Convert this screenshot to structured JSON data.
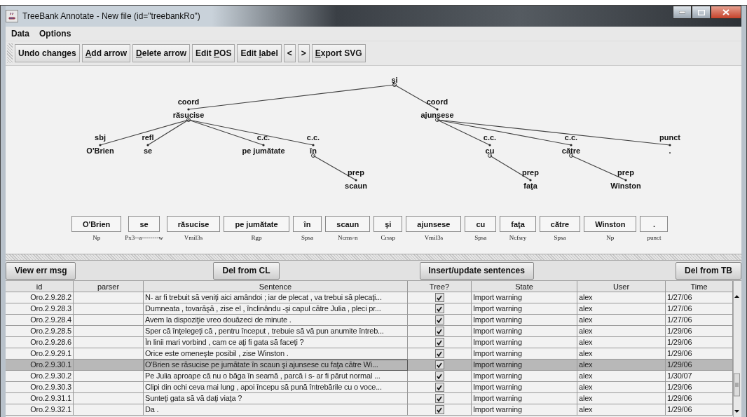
{
  "window": {
    "title": "TreeBank Annotate - New file (id=\"treebankRo\")"
  },
  "menu": [
    "Data",
    "Options"
  ],
  "toolbar": [
    {
      "pre": "Undo changes"
    },
    {
      "key": "A",
      "post": "dd arrow"
    },
    {
      "key": "D",
      "post": "elete arrow"
    },
    {
      "pre": "Edit ",
      "key": "P",
      "post": "OS"
    },
    {
      "pre": "Edit ",
      "key": "l",
      "post": "abel"
    },
    {
      "pre": "<"
    },
    {
      "pre": ">"
    },
    {
      "key": "E",
      "post": "xport SVG"
    }
  ],
  "tree": {
    "word": "şi",
    "children": [
      {
        "relation": "coord",
        "word": "răsucise",
        "children": [
          {
            "relation": "sbj",
            "word": "O'Brien"
          },
          {
            "relation": "refl",
            "word": "se"
          },
          {
            "relation": "c.c.",
            "word": "pe jumătate"
          },
          {
            "relation": "c.c.",
            "word": "în",
            "children": [
              {
                "relation": "prep",
                "word": "scaun"
              }
            ]
          }
        ]
      },
      {
        "relation": "coord",
        "word": "ajunsese",
        "children": [
          {
            "relation": "c.c.",
            "word": "cu",
            "children": [
              {
                "relation": "prep",
                "word": "faţa"
              }
            ]
          },
          {
            "relation": "c.c.",
            "word": "către",
            "children": [
              {
                "relation": "prep",
                "word": "Winston"
              }
            ]
          },
          {
            "relation": "punct",
            "word": "."
          }
        ]
      }
    ]
  },
  "tokens": [
    {
      "word": "O'Brien",
      "tag": "Np"
    },
    {
      "word": "se",
      "tag": "Px3--a--------w"
    },
    {
      "word": "răsucise",
      "tag": "Vmil3s"
    },
    {
      "word": "pe jumătate",
      "tag": "Rgp"
    },
    {
      "word": "în",
      "tag": "Spsa"
    },
    {
      "word": "scaun",
      "tag": "Ncms-n"
    },
    {
      "word": "şi",
      "tag": "Crssp"
    },
    {
      "word": "ajunsese",
      "tag": "Vmil3s"
    },
    {
      "word": "cu",
      "tag": "Spsa"
    },
    {
      "word": "faţa",
      "tag": "Ncfsry"
    },
    {
      "word": "către",
      "tag": "Spsa"
    },
    {
      "word": "Winston",
      "tag": "Np"
    },
    {
      "word": ".",
      "tag": "punct"
    }
  ],
  "actions": [
    "View err msg",
    "Del from CL",
    "Insert/update sentences",
    "Del from TB"
  ],
  "table": {
    "columns": [
      "id",
      "parser",
      "Sentence",
      "Tree?",
      "State",
      "User",
      "Time"
    ],
    "rows": [
      {
        "id": "Oro.2.9.28.2",
        "sentence": "N- ar fi trebuit să veniţi aici amândoi ; iar de plecat , va trebui să plecaţi...",
        "tree": true,
        "state": "Import warning",
        "user": "alex",
        "time": "1/27/06",
        "selected": false
      },
      {
        "id": "Oro.2.9.28.3",
        "sentence": "Dumneata , tovarăşă , zise el , înclinându -şi capul către Julia , pleci pr...",
        "tree": true,
        "state": "Import warning",
        "user": "alex",
        "time": "1/27/06",
        "selected": false
      },
      {
        "id": "Oro.2.9.28.4",
        "sentence": "Avem la dispoziţie vreo douăzeci de minute .",
        "tree": true,
        "state": "Import warning",
        "user": "alex",
        "time": "1/27/06",
        "selected": false
      },
      {
        "id": "Oro.2.9.28.5",
        "sentence": "Sper că înţelegeţi că , pentru început , trebuie să vă pun anumite întreb...",
        "tree": true,
        "state": "Import warning",
        "user": "alex",
        "time": "1/29/06",
        "selected": false
      },
      {
        "id": "Oro.2.9.28.6",
        "sentence": "În linii mari vorbind , cam ce aţi fi gata să faceţi ?",
        "tree": true,
        "state": "Import warning",
        "user": "alex",
        "time": "1/29/06",
        "selected": false
      },
      {
        "id": "Oro.2.9.29.1",
        "sentence": "Orice este omeneşte posibil , zise Winston .",
        "tree": true,
        "state": "Import warning",
        "user": "alex",
        "time": "1/29/06",
        "selected": false
      },
      {
        "id": "Oro.2.9.30.1",
        "sentence": "O'Brien se răsucise pe jumătate în scaun şi ajunsese cu faţa către Wi...",
        "tree": true,
        "state": "Import warning",
        "user": "alex",
        "time": "1/29/06",
        "selected": true
      },
      {
        "id": "Oro.2.9.30.2",
        "sentence": "Pe Julia aproape că nu o băga în seamă , parcă i s- ar fi părut normal ...",
        "tree": true,
        "state": "Import warning",
        "user": "alex",
        "time": "1/30/07",
        "selected": false
      },
      {
        "id": "Oro.2.9.30.3",
        "sentence": "Clipi din ochi ceva mai lung , apoi începu să pună întrebările cu o voce...",
        "tree": true,
        "state": "Import warning",
        "user": "alex",
        "time": "1/29/06",
        "selected": false
      },
      {
        "id": "Oro.2.9.31.1",
        "sentence": "Sunteţi gata să vă daţi viaţa ?",
        "tree": true,
        "state": "Import warning",
        "user": "alex",
        "time": "1/29/06",
        "selected": false
      },
      {
        "id": "Oro.2.9.32.1",
        "sentence": "Da .",
        "tree": true,
        "state": "Import warning",
        "user": "alex",
        "time": "1/29/06",
        "selected": false
      }
    ]
  }
}
